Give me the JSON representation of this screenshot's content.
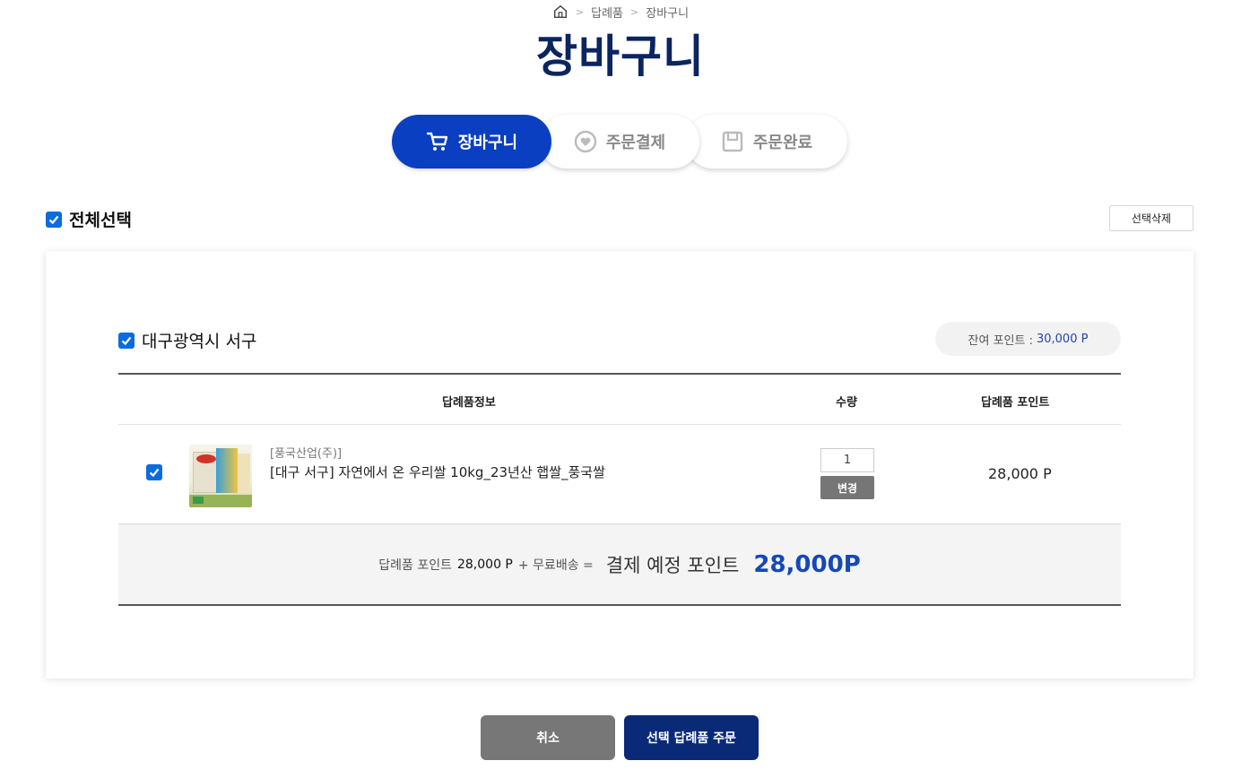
{
  "breadcrumb": {
    "items": [
      "답례품",
      "장바구니"
    ]
  },
  "page_title": "장바구니",
  "steps": [
    {
      "label": "장바구니",
      "icon": "cart-icon",
      "active": true
    },
    {
      "label": "주문결제",
      "icon": "heart-circle-icon",
      "active": false
    },
    {
      "label": "주문완료",
      "icon": "save-box-icon",
      "active": false
    }
  ],
  "select_all": {
    "label": "전체선택",
    "checked": true
  },
  "delete_selected_label": "선택삭제",
  "group": {
    "region": "대구광역시 서구",
    "checked": true,
    "remaining_points_label": "잔여 포인트 :",
    "remaining_points_value": "30,000 P"
  },
  "table": {
    "headers": {
      "info": "답례품정보",
      "qty": "수량",
      "points": "답례품 포인트"
    },
    "rows": [
      {
        "checked": true,
        "seller": "[풍국산업(주)]",
        "name": "[대구 서구] 자연에서 온 우리쌀 10kg_23년산 햅쌀_풍국쌀",
        "qty": "1",
        "change_label": "변경",
        "price": "28,000 P"
      }
    ]
  },
  "summary": {
    "goods_label": "답례품 포인트",
    "goods_value": "28,000 P",
    "shipping": "+ 무료배송 =",
    "total_label": "결제 예정 포인트",
    "total_value": "28,000P"
  },
  "buttons": {
    "cancel": "취소",
    "order": "선택 답례품 주문"
  },
  "colors": {
    "primary": "#0b3fc2",
    "title": "#0a2560",
    "checkbox": "#0a6cde",
    "order_button": "#0a2a78",
    "cancel_button": "#777777",
    "total": "#1548b8"
  }
}
